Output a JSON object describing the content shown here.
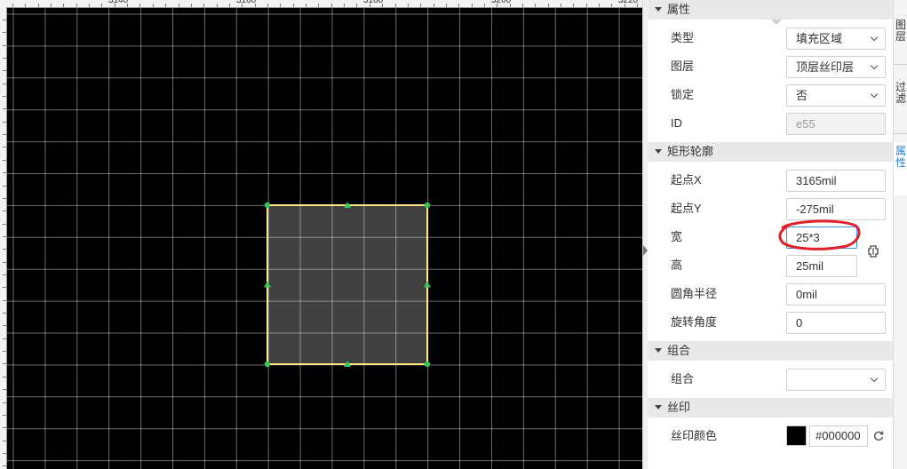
{
  "ruler": {
    "labels": [
      "3140",
      "3160",
      "3180",
      "3200",
      "3220"
    ]
  },
  "canvas": {
    "background": "#000000",
    "grid_color": "#ffffff",
    "shape_fill": "#404040",
    "shape_stroke": "#ffe680",
    "handle_color": "#35c75a"
  },
  "panel": {
    "attributes": {
      "title": "属性",
      "type_label": "类型",
      "type_value": "填充区域",
      "layer_label": "图层",
      "layer_value": "顶层丝印层",
      "lock_label": "锁定",
      "lock_value": "否",
      "id_label": "ID",
      "id_value": "e55"
    },
    "rect": {
      "title": "矩形轮廓",
      "x_label": "起点X",
      "x_value": "3165mil",
      "y_label": "起点Y",
      "y_value": "-275mil",
      "w_label": "宽",
      "w_value": "25*3",
      "h_label": "高",
      "h_value": "25mil",
      "r_label": "圆角半径",
      "r_value": "0mil",
      "rot_label": "旋转角度",
      "rot_value": "0"
    },
    "group": {
      "title": "组合",
      "label": "组合",
      "value": ""
    },
    "silk": {
      "title": "丝印",
      "color_label": "丝印颜色",
      "color_value": "#000000"
    }
  },
  "tabs": {
    "layers": "图层",
    "filter": "过滤",
    "props": "属性"
  },
  "colors": {
    "accent": "#2a7fd4",
    "annotation": "#e0202a"
  }
}
